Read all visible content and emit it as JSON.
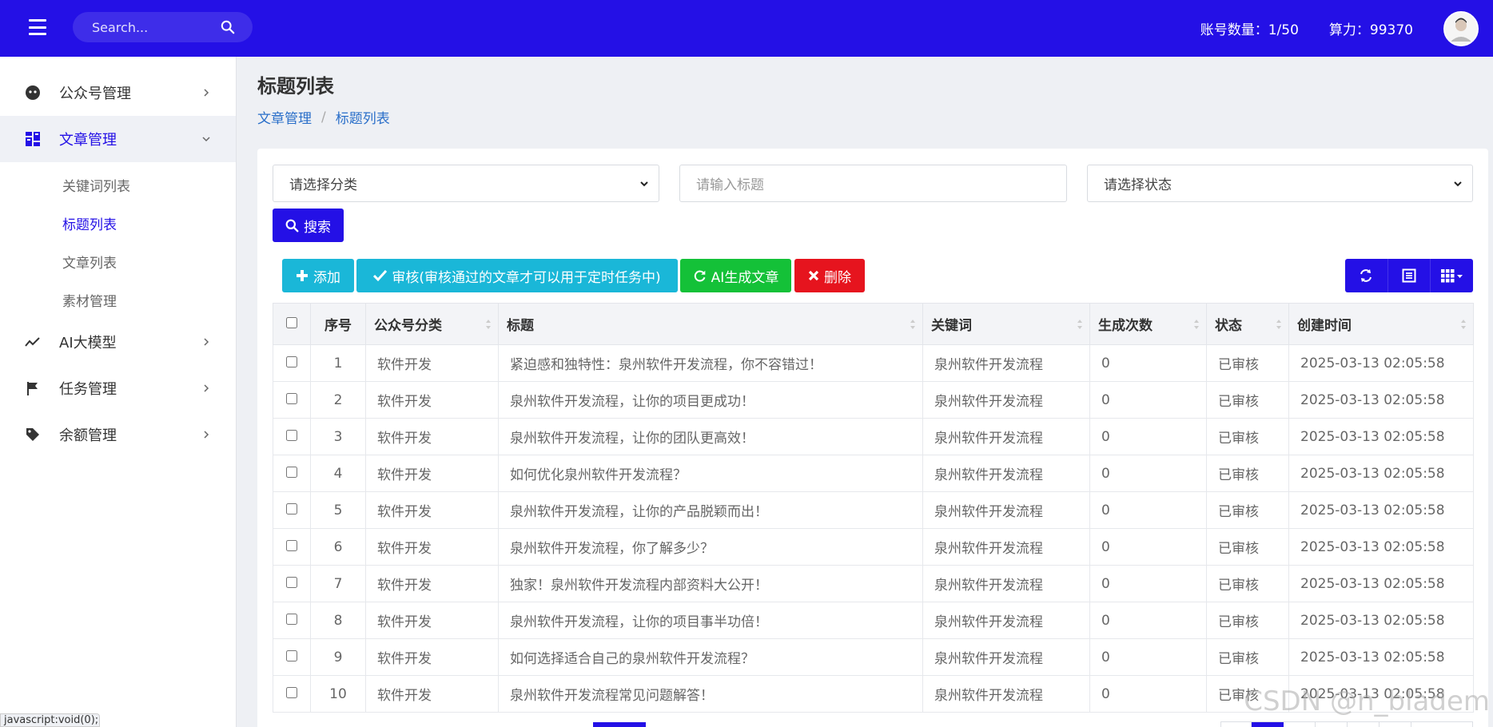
{
  "header": {
    "search_placeholder": "Search...",
    "account_count": "账号数量：1/50",
    "compute_power": "算力：99370"
  },
  "sidebar": {
    "items": [
      {
        "label": "公众号管理"
      },
      {
        "label": "文章管理"
      },
      {
        "label": "AI大模型"
      },
      {
        "label": "任务管理"
      },
      {
        "label": "余额管理"
      }
    ],
    "sub_items": [
      {
        "label": "关键词列表"
      },
      {
        "label": "标题列表"
      },
      {
        "label": "文章列表"
      },
      {
        "label": "素材管理"
      }
    ]
  },
  "page": {
    "title": "标题列表",
    "breadcrumb": [
      "文章管理",
      "标题列表"
    ]
  },
  "filters": {
    "category_select": "请选择分类",
    "title_placeholder": "请输入标题",
    "status_select": "请选择状态",
    "search_button": "搜索"
  },
  "toolbar": {
    "add": "添加",
    "review": "审核(审核通过的文章才可以用于定时任务中)",
    "ai_generate": "AI生成文章",
    "delete": "删除"
  },
  "table": {
    "columns": [
      "序号",
      "公众号分类",
      "标题",
      "关键词",
      "生成次数",
      "状态",
      "创建时间"
    ],
    "rows": [
      {
        "id": "1",
        "category": "软件开发",
        "title": "紧迫感和独特性：泉州软件开发流程，你不容错过！",
        "keyword": "泉州软件开发流程",
        "count": "0",
        "status": "已审核",
        "created": "2025-03-13 02:05:58"
      },
      {
        "id": "2",
        "category": "软件开发",
        "title": "泉州软件开发流程，让你的项目更成功！",
        "keyword": "泉州软件开发流程",
        "count": "0",
        "status": "已审核",
        "created": "2025-03-13 02:05:58"
      },
      {
        "id": "3",
        "category": "软件开发",
        "title": "泉州软件开发流程，让你的团队更高效！",
        "keyword": "泉州软件开发流程",
        "count": "0",
        "status": "已审核",
        "created": "2025-03-13 02:05:58"
      },
      {
        "id": "4",
        "category": "软件开发",
        "title": "如何优化泉州软件开发流程？",
        "keyword": "泉州软件开发流程",
        "count": "0",
        "status": "已审核",
        "created": "2025-03-13 02:05:58"
      },
      {
        "id": "5",
        "category": "软件开发",
        "title": "泉州软件开发流程，让你的产品脱颖而出！",
        "keyword": "泉州软件开发流程",
        "count": "0",
        "status": "已审核",
        "created": "2025-03-13 02:05:58"
      },
      {
        "id": "6",
        "category": "软件开发",
        "title": "泉州软件开发流程，你了解多少？",
        "keyword": "泉州软件开发流程",
        "count": "0",
        "status": "已审核",
        "created": "2025-03-13 02:05:58"
      },
      {
        "id": "7",
        "category": "软件开发",
        "title": "独家！泉州软件开发流程内部资料大公开！",
        "keyword": "泉州软件开发流程",
        "count": "0",
        "status": "已审核",
        "created": "2025-03-13 02:05:58"
      },
      {
        "id": "8",
        "category": "软件开发",
        "title": "泉州软件开发流程，让你的项目事半功倍！",
        "keyword": "泉州软件开发流程",
        "count": "0",
        "status": "已审核",
        "created": "2025-03-13 02:05:58"
      },
      {
        "id": "9",
        "category": "软件开发",
        "title": "如何选择适合自己的泉州软件开发流程？",
        "keyword": "泉州软件开发流程",
        "count": "0",
        "status": "已审核",
        "created": "2025-03-13 02:05:58"
      },
      {
        "id": "10",
        "category": "软件开发",
        "title": "泉州软件开发流程常见问题解答！",
        "keyword": "泉州软件开发流程",
        "count": "0",
        "status": "已审核",
        "created": "2025-03-13 02:05:58"
      }
    ]
  },
  "statusbar": {
    "text": "javascript:void(0);"
  },
  "watermark": {
    "text": "CSDN @n_bladem"
  },
  "colors": {
    "primary": "#2410e6",
    "add": "#1ab7d8",
    "review": "#1ab7d8",
    "ai": "#14c138",
    "delete": "#e6141e"
  }
}
